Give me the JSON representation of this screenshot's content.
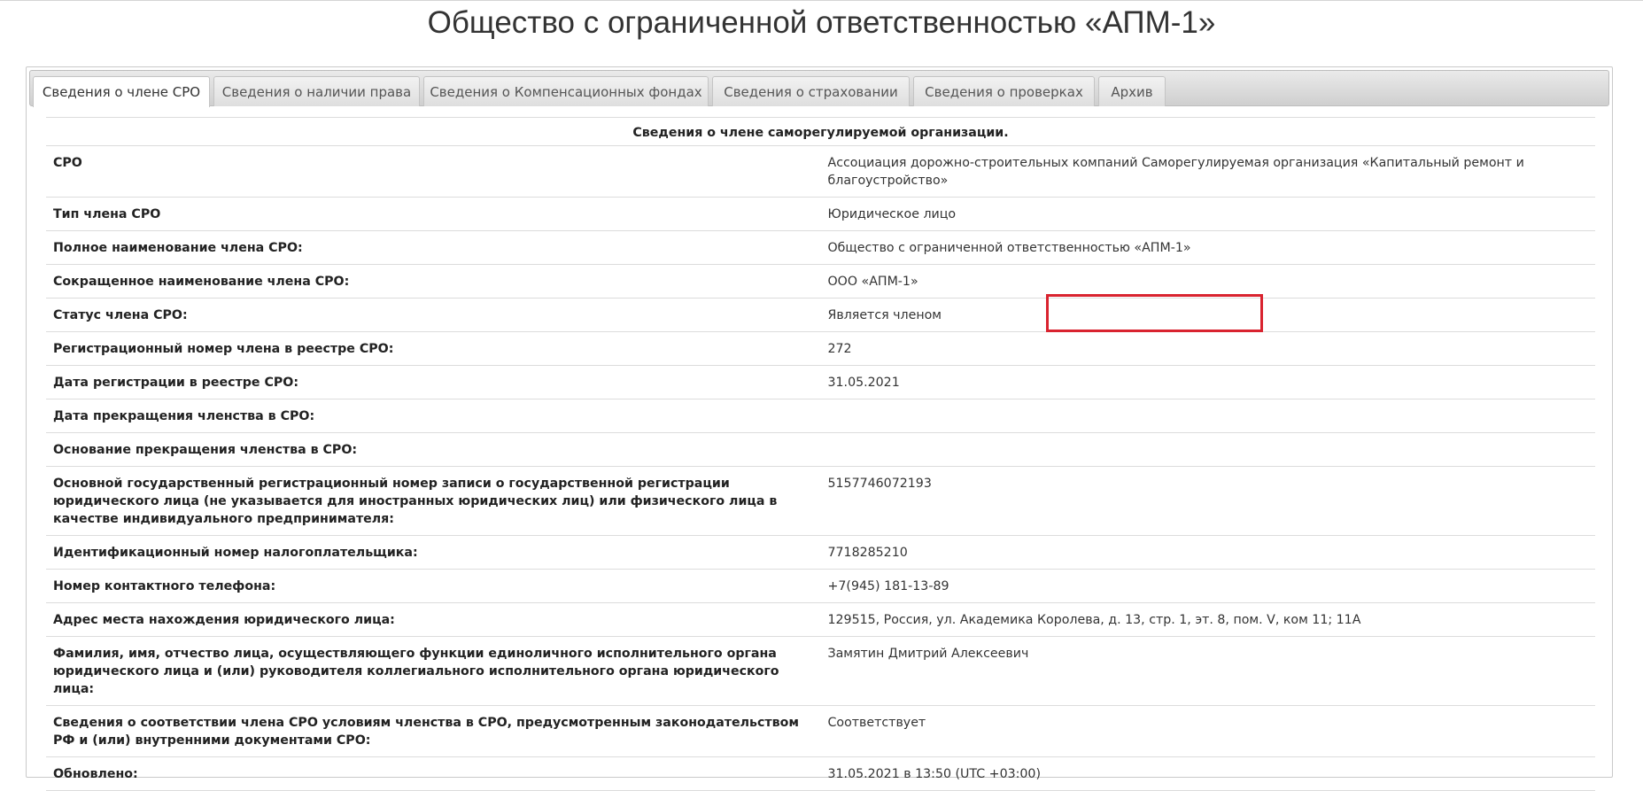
{
  "page": {
    "title": "Общество с ограниченной ответственностью «АПМ-1»"
  },
  "tabs": [
    {
      "label": "Сведения о члене СРО"
    },
    {
      "label": "Сведения о наличии права"
    },
    {
      "label": "Сведения о Компенсационных фондах"
    },
    {
      "label": "Сведения о страховании"
    },
    {
      "label": "Сведения о проверках"
    },
    {
      "label": "Архив"
    }
  ],
  "table": {
    "heading": "Сведения о члене саморегулируемой организации.",
    "rows": [
      {
        "label": "СРО",
        "value": "Ассоциация дорожно-строительных компаний Саморегулируемая организация «Капитальный ремонт и благоустройство»"
      },
      {
        "label": "Тип члена СРО",
        "value": "Юридическое лицо"
      },
      {
        "label": "Полное наименование члена СРО:",
        "value": "Общество с ограниченной ответственностью «АПМ-1»"
      },
      {
        "label": "Сокращенное наименование члена СРО:",
        "value": "ООО «АПМ-1»"
      },
      {
        "label": "Статус члена СРО:",
        "value": "Является членом"
      },
      {
        "label": "Регистрационный номер члена в реестре СРО:",
        "value": "272"
      },
      {
        "label": "Дата регистрации в реестре СРО:",
        "value": "31.05.2021"
      },
      {
        "label": "Дата прекращения членства в СРО:",
        "value": ""
      },
      {
        "label": "Основание прекращения членства в СРО:",
        "value": ""
      },
      {
        "label": "Основной государственный регистрационный номер записи о государственной регистрации юридического лица (не указывается для иностранных юридических лиц) или физического лица в качестве индивидуального предпринимателя:",
        "value": "5157746072193"
      },
      {
        "label": "Идентификационный номер налогоплательщика:",
        "value": "7718285210"
      },
      {
        "label": "Номер контактного телефона:",
        "value": "+7(945) 181-13-89"
      },
      {
        "label": "Адрес места нахождения юридического лица:",
        "value": "129515, Россия, ул. Академика Королева, д. 13, стр. 1, эт. 8, пом. V, ком 11; 11А"
      },
      {
        "label": "Фамилия, имя, отчество лица, осуществляющего функции единоличного исполнительного органа юридического лица и (или) руководителя коллегиального исполнительного органа юридического лица:",
        "value": "Замятин Дмитрий Алексеевич"
      },
      {
        "label": "Сведения о соответствии члена СРО условиям членства в СРО, предусмотренным законодательством РФ и (или) внутренними документами СРО:",
        "value": "Соответствует"
      },
      {
        "label": "Обновлено:",
        "value": "31.05.2021 в 13:50 (UTC +03:00)"
      }
    ]
  },
  "colors": {
    "highlight": "#d9232f"
  }
}
